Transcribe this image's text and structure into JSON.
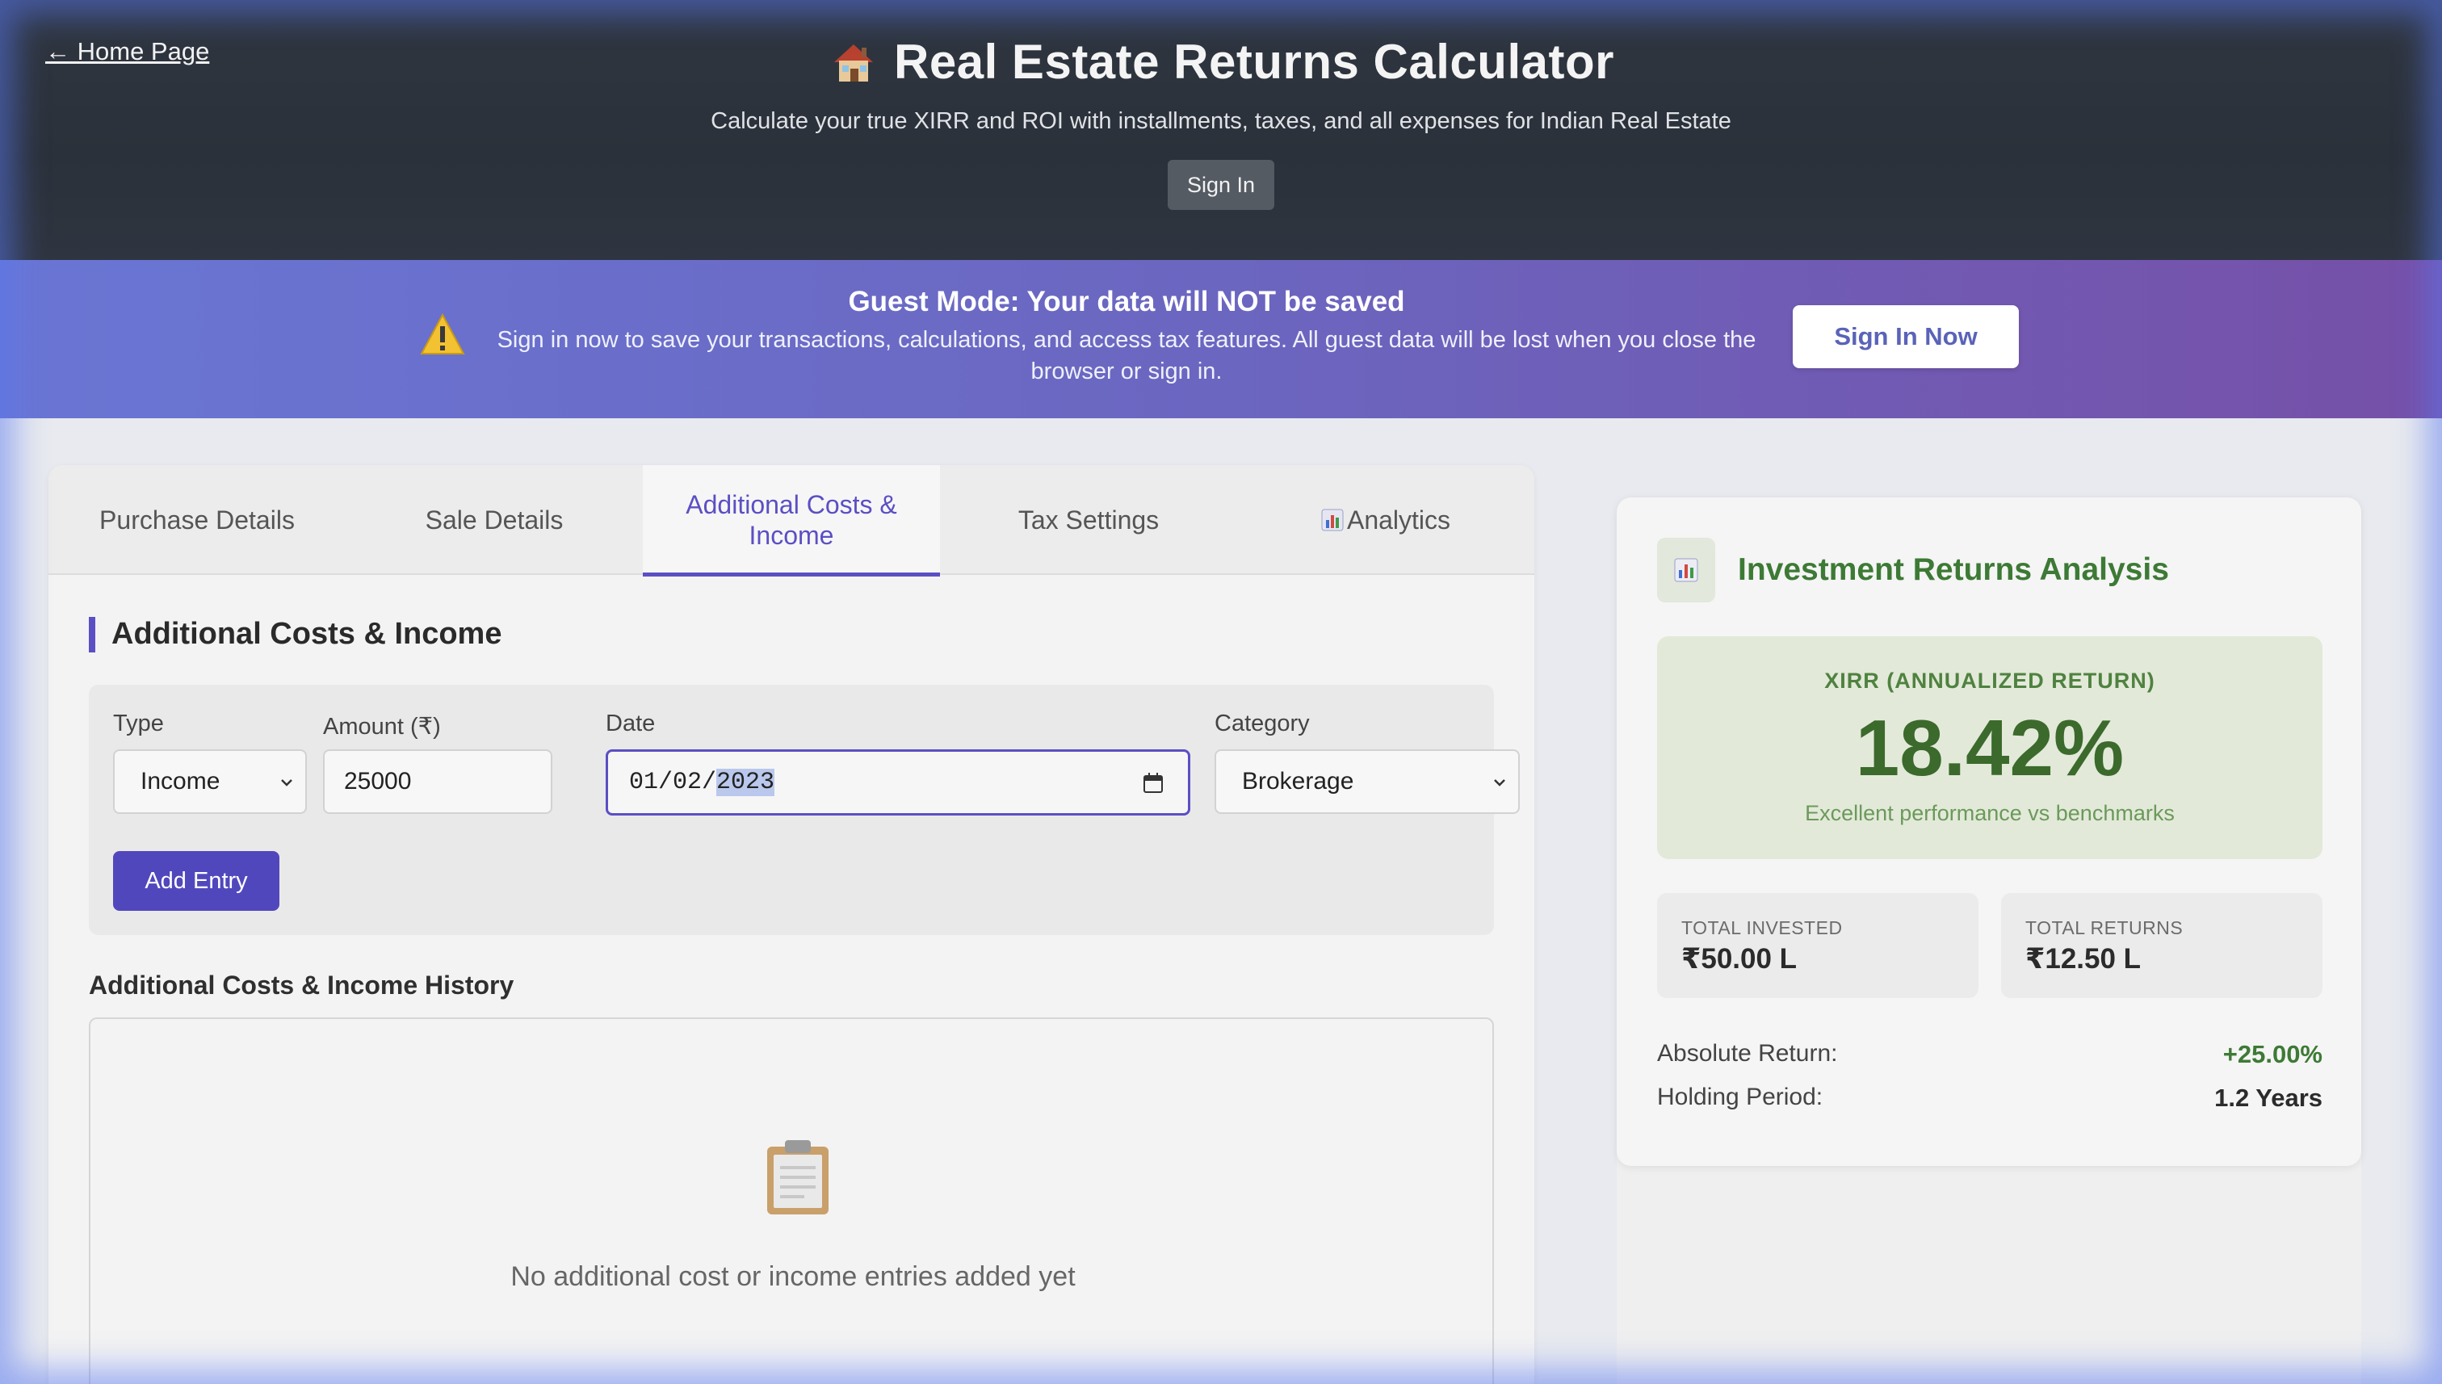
{
  "header": {
    "home_link": "← Home Page",
    "title": "Real Estate Returns Calculator",
    "subtitle": "Calculate your true XIRR and ROI with installments, taxes, and all expenses for Indian Real Estate",
    "sign_in_label": "Sign In"
  },
  "banner": {
    "title": "Guest Mode: Your data will NOT be saved",
    "text": "Sign in now to save your transactions, calculations, and access tax features. All guest data will be lost when you close the browser or sign in.",
    "button_label": "Sign In Now"
  },
  "tabs": [
    {
      "label": "Purchase Details",
      "active": false
    },
    {
      "label": "Sale Details",
      "active": false
    },
    {
      "label": "Additional Costs & Income",
      "active": true
    },
    {
      "label": "Tax Settings",
      "active": false
    },
    {
      "label": "Analytics",
      "active": false
    }
  ],
  "form": {
    "section_title": "Additional Costs & Income",
    "type_label": "Type",
    "type_value": "Income",
    "amount_label": "Amount (₹)",
    "amount_value": "25000",
    "date_label": "Date",
    "date_prefix": "01/02/",
    "date_year": "2023",
    "category_label": "Category",
    "category_value": "Brokerage",
    "add_button": "Add Entry"
  },
  "history": {
    "title": "Additional Costs & Income History",
    "empty_text": "No additional cost or income entries added yet"
  },
  "analysis": {
    "title": "Investment Returns Analysis",
    "xirr_label": "XIRR (ANNUALIZED RETURN)",
    "xirr_value": "18.42%",
    "xirr_note": "Excellent performance vs benchmarks",
    "total_invested_label": "TOTAL INVESTED",
    "total_invested_value": "₹50.00 L",
    "total_returns_label": "TOTAL RETURNS",
    "total_returns_value": "₹12.50 L",
    "absolute_return_label": "Absolute Return:",
    "absolute_return_value": "+25.00%",
    "holding_period_label": "Holding Period:",
    "holding_period_value": "1.2 Years"
  },
  "colors": {
    "accent": "#5b4fc4",
    "positive": "#3d7a35",
    "header_bg": "#2f3640",
    "banner_start": "#6a76d4",
    "banner_end": "#7650a8"
  },
  "icons": {
    "title": "house-icon",
    "banner": "warning-icon",
    "analytics_tab": "bar-chart-icon",
    "history_empty": "clipboard-icon",
    "analysis": "bar-chart-icon"
  }
}
